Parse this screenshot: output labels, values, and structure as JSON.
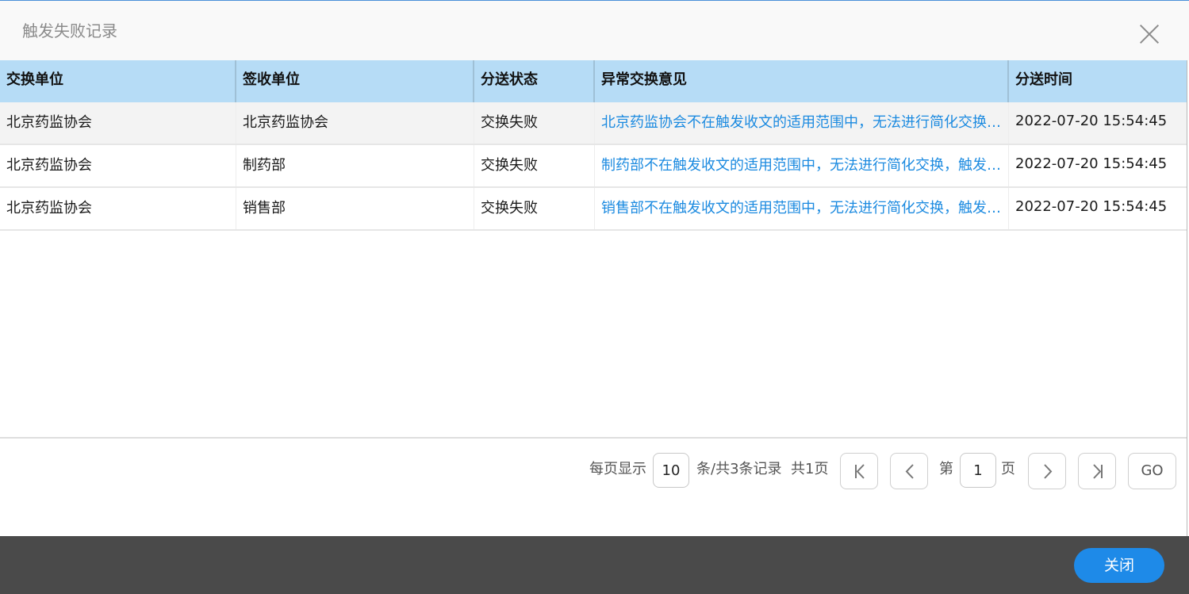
{
  "dialog": {
    "title": "触发失败记录"
  },
  "table": {
    "headers": [
      "交换单位",
      "签收单位",
      "分送状态",
      "异常交换意见",
      "分送时间"
    ],
    "rows": [
      {
        "exchange_unit": "北京药监协会",
        "receiving_unit": "北京药监协会",
        "status": "交换失败",
        "opinion": "北京药监协会不在触发收文的适用范围中，无法进行简化交换，触发收文失败",
        "time": "2022-07-20 15:54:45"
      },
      {
        "exchange_unit": "北京药监协会",
        "receiving_unit": "制药部",
        "status": "交换失败",
        "opinion": "制药部不在触发收文的适用范围中，无法进行简化交换，触发收文失败",
        "time": "2022-07-20 15:54:45"
      },
      {
        "exchange_unit": "北京药监协会",
        "receiving_unit": "销售部",
        "status": "交换失败",
        "opinion": "销售部不在触发收文的适用范围中，无法进行简化交换，触发收文失败",
        "time": "2022-07-20 15:54:45"
      }
    ]
  },
  "pager": {
    "per_page_label": "每页显示",
    "page_size": "10",
    "records_label": "条/共3条记录",
    "total_pages_label": "共1页",
    "page_prefix": "第",
    "current_page": "1",
    "page_suffix": "页",
    "go_label": "GO",
    "icons": [
      "first-page-icon",
      "prev-page-icon",
      "next-page-icon",
      "last-page-icon"
    ]
  },
  "footer": {
    "close_label": "关闭"
  },
  "colors": {
    "header_bg": "#b6dcf6",
    "link": "#1b8ae0",
    "primary": "#1e8ae8",
    "bottom_bar": "#4a4a4a"
  }
}
